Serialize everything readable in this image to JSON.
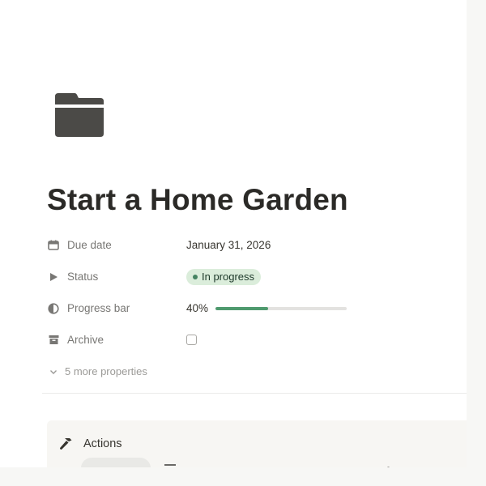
{
  "page": {
    "title": "Start a Home Garden",
    "icon": "folder-icon"
  },
  "properties": [
    {
      "label": "Due date",
      "icon": "calendar-icon",
      "value": "January 31, 2026"
    },
    {
      "label": "Status",
      "icon": "play-triangle-icon",
      "value": "In progress"
    },
    {
      "label": "Progress bar",
      "icon": "pie-chart-icon",
      "value": "40%",
      "progress": 0.4
    },
    {
      "label": "Archive",
      "icon": "archive-box-icon",
      "checked": false
    }
  ],
  "more_properties": {
    "label": "5 more properties",
    "icon": "chevron-down-icon"
  },
  "actions": {
    "label": "Actions",
    "icon": "hammer-icon"
  },
  "colors": {
    "status_bg": "#dbeddb",
    "status_dot": "#448361",
    "progress_fill": "#4f9a6e",
    "progress_track": "#e3e2e0",
    "icon_dark": "#4b4a47"
  }
}
